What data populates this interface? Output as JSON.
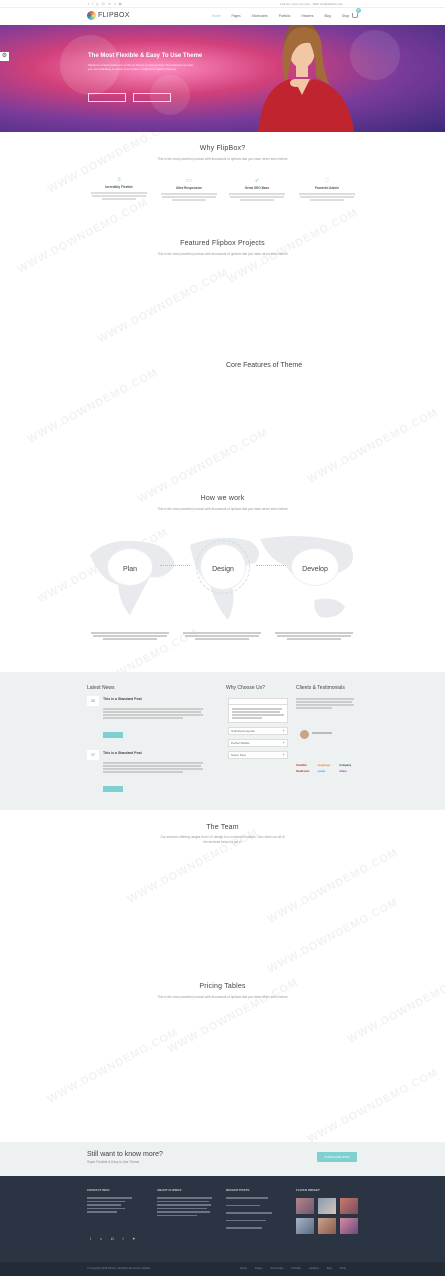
{
  "topbar": {
    "contact": "Call Us: (xxx) xxx-xxxx  ·  Mail: info@flipbox.com",
    "social_icons": [
      "twitter-icon",
      "facebook-icon",
      "google-plus-icon",
      "dribbble-icon",
      "linkedin-icon",
      "vimeo-icon",
      "youtube-icon"
    ]
  },
  "header": {
    "logo_text": "FLIPBOX",
    "nav": [
      "Home",
      "Pages",
      "Shortcodes",
      "Portfolio",
      "Headers",
      "Blog",
      "Shop"
    ],
    "cart_count": "0"
  },
  "hero": {
    "title": "The Most Flexible & Easy To Use Theme",
    "text": "Flipbox's unique feature is of the lot theme to choose from Themeforest so well you can definitely in select your choice of Flipbox's options themes"
  },
  "why": {
    "title": "Why FlipBox?",
    "subtitle": "This is the most powerful product with thousands of options that you have never seen before",
    "features": [
      {
        "icon": "sliders-icon",
        "title": "Incredibly Flexible"
      },
      {
        "icon": "monitor-icon",
        "title": "Ultra Responsive"
      },
      {
        "icon": "rocket-icon",
        "title": "Great SEO Base"
      },
      {
        "icon": "heart-icon",
        "title": "Powerful Admin"
      }
    ]
  },
  "projects": {
    "title": "Featured Flipbox Projects",
    "subtitle": "This is the most powerful product with thousands of options that you have never seen before"
  },
  "core": {
    "title": "Core Features of Theme"
  },
  "how": {
    "title": "How we work",
    "subtitle": "This is the most powerful product with thousands of options that you have never seen before",
    "steps": [
      "Plan",
      "Design",
      "Develop"
    ]
  },
  "news": {
    "title": "Latest News",
    "posts": [
      {
        "day": "20",
        "title": "This is a Standard Post"
      },
      {
        "day": "17",
        "title": "This is a Standard Post"
      }
    ]
  },
  "choose": {
    "title": "Why Choose Us?",
    "items": [
      "Unlimited Layouts",
      "Perfect Builds",
      "Super Fast"
    ]
  },
  "clients": {
    "title": "Clients & Testimonials",
    "logos": [
      "SmallBiz",
      "rangelogo",
      "Company",
      "RealEstate",
      "ocean",
      "Aidea"
    ]
  },
  "team": {
    "title": "The Team",
    "subtitle": "Our services offering ranges from UX design to e-commerce setups. Not check out all of the services below to get it."
  },
  "pricing": {
    "title": "Pricing Tables",
    "subtitle": "This is the most powerful product with thousands of options that you have never seen before"
  },
  "cta": {
    "title": "Still want to know more?",
    "subtitle": "Super Flexible & Easy to Use Theme",
    "button": "PURCHASE NOW"
  },
  "footer": {
    "columns": [
      "CONTACT INFO",
      "ABOUT FLIPBOX",
      "RECENT POSTS",
      "FLICKR WIDGET"
    ],
    "social_icons": [
      "twitter-icon",
      "vimeo-icon",
      "instagram-icon",
      "facebook-icon",
      "heart-icon"
    ],
    "copyright": "© Copyright 2015 Flipbox. All Rights Reserved. FlipBox",
    "nav": [
      "Home",
      "Pages",
      "Shortcodes",
      "Portfolio",
      "Headers",
      "Blog",
      "Shop"
    ]
  },
  "watermark": "WWW.DOWNDEMO.COM",
  "colors": {
    "accent": "#7fd0d0",
    "footer_bg": "#2b3442",
    "hero_start": "#d2407a",
    "hero_end": "#3a2a7a"
  }
}
